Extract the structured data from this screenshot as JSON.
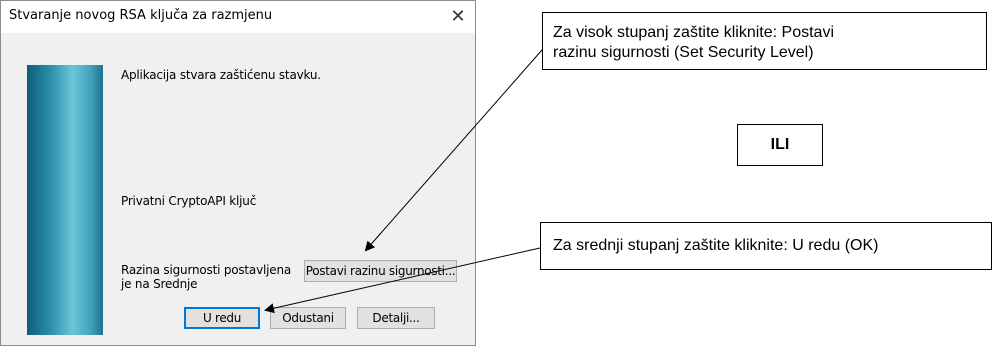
{
  "dialog": {
    "title": "Stvaranje novog RSA ključa za razmjenu",
    "close_glyph": "✕",
    "message": "Aplikacija stvara zaštićenu stavku.",
    "key_label": "Privatni CryptoAPI ključ",
    "security_line1": "Razina sigurnosti postavljena",
    "security_line2": "je na Srednje",
    "set_security_button": "Postavi razinu sigurnosti...",
    "ok_button": "U redu",
    "cancel_button": "Odustani",
    "details_button": "Detalji..."
  },
  "callouts": {
    "high_line1": "Za visok stupanj zaštite kliknite: Postavi",
    "high_line2": "razinu sigurnosti (Set Security Level)",
    "or": "ILI",
    "medium": "Za srednji stupanj zaštite kliknite: U redu (OK)"
  },
  "colors": {
    "accent": "#0078d7",
    "dialog_bg": "#f0f0f0",
    "side_graphic": "#2a8eaa"
  }
}
